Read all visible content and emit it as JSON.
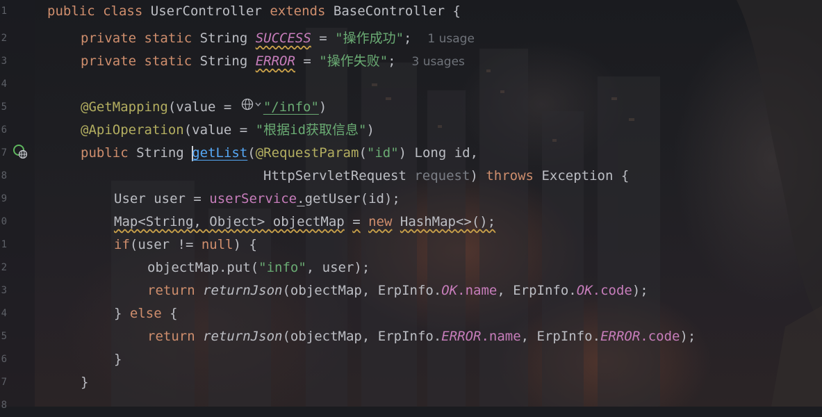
{
  "editor": {
    "line_numbers": [
      "1",
      "2",
      "3",
      "4",
      "5",
      "6",
      "7",
      "8",
      "9",
      "0",
      "1",
      "2",
      "3",
      "4",
      "5",
      "6",
      "7",
      "8"
    ],
    "code": {
      "l1": {
        "kw_public": "public",
        "kw_class": "class",
        "class_name": "UserController",
        "kw_extends": "extends",
        "base_class": "BaseController",
        "brace": "{"
      },
      "l2": {
        "kw_private": "private",
        "kw_static": "static",
        "type": "String",
        "field": "SUCCESS",
        "eq": "=",
        "value": "\"操作成功\"",
        "semi": ";",
        "usages": "1 usage"
      },
      "l3": {
        "kw_private": "private",
        "kw_static": "static",
        "type": "String",
        "field": "ERROR",
        "eq": "=",
        "value": "\"操作失败\"",
        "semi": ";",
        "usages": "3 usages"
      },
      "l5": {
        "annotation": "@GetMapping",
        "open": "(value =",
        "value": "\"/info\"",
        "close": ")"
      },
      "l6": {
        "annotation": "@ApiOperation",
        "open": "(value =",
        "value": "\"根据id获取信息\"",
        "close": ")"
      },
      "l7": {
        "kw_public": "public",
        "type": "String",
        "method": "getList",
        "paren": "(",
        "annotation": "@RequestParam",
        "ann_open": "(",
        "ann_value": "\"id\"",
        "rest": ") Long id,"
      },
      "l8": {
        "type": "HttpServletRequest",
        "param": "request",
        "paren": ")",
        "kw_throws": "throws",
        "rest": "Exception {"
      },
      "l9": {
        "decl": "User user =",
        "service": "userService",
        "dot": ".",
        "call": "getUser(id);"
      },
      "l10": {
        "decl": "Map<String, Object> objectMap",
        "eq": "=",
        "kw_new": "new",
        "rest": "HashMap<>();"
      },
      "l11": {
        "kw_if": "if",
        "cond": "(user !=",
        "kw_null": "null",
        "rest": ") {"
      },
      "l12": {
        "prefix": "objectMap.put(",
        "key": "\"info\"",
        "rest": ", user);"
      },
      "l13": {
        "kw_return": "return",
        "call": "returnJson",
        "args": "(objectMap, ErpInfo.",
        "c1": "OK",
        "f1": ".name",
        "mid": ", ErpInfo.",
        "c2": "OK",
        "f2": ".code",
        "end": ");"
      },
      "l14": {
        "open": "}",
        "kw_else": "else",
        "close": "{"
      },
      "l15": {
        "kw_return": "return",
        "call": "returnJson",
        "args": "(objectMap, ErpInfo.",
        "c1": "ERROR",
        "f1": ".name",
        "mid": ", ErpInfo.",
        "c2": "ERROR",
        "f2": ".code",
        "end": ");"
      },
      "l16": {
        "brace": "}"
      },
      "l17": {
        "brace": "}"
      }
    },
    "icons": {
      "gutter": "web-endpoint-gutter-icon",
      "inline": "globe-url-icon"
    },
    "colors": {
      "keyword": "#cf8e6d",
      "string": "#6aab73",
      "annotation": "#b3ae60",
      "static_field": "#c77dbb",
      "method_decl": "#56a8f5",
      "text": "#bcbec4",
      "hint": "#6f737a"
    }
  }
}
